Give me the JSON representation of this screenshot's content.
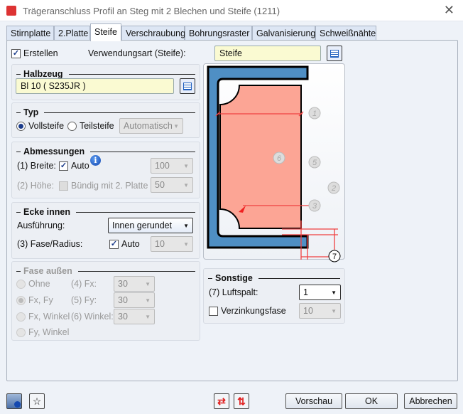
{
  "window": {
    "title": "Trägeranschluss Profil an Steg mit 2 Blechen und Steife (1211)",
    "close": "✕"
  },
  "tabs": [
    {
      "label": "Stirnplatte"
    },
    {
      "label": "2.Platte"
    },
    {
      "label": "Steife",
      "active": true
    },
    {
      "label": "Verschraubung"
    },
    {
      "label": "Bohrungsraster"
    },
    {
      "label": "Galvanisierung"
    },
    {
      "label": "Schweißnähte"
    }
  ],
  "top": {
    "create_label": "Erstellen",
    "create_checked": true,
    "usage_label": "Verwendungsart (Steife):",
    "usage_value": "Steife"
  },
  "halbzeug": {
    "title": "Halbzeug",
    "value": "Bl 10  ( S235JR )"
  },
  "typ": {
    "title": "Typ",
    "option1": "Vollsteife",
    "option2": "Teilsteife",
    "selected": "Vollsteife",
    "mode": "Automatisch"
  },
  "abmessungen": {
    "title": "Abmessungen",
    "breite_label": "(1) Breite:",
    "auto_label": "Auto",
    "breite_value": "100",
    "hoehe_label": "(2) Höhe:",
    "buendig_label": "Bündig mit 2. Platte",
    "hoehe_value": "50"
  },
  "ecke": {
    "title": "Ecke innen",
    "ausfuehrung_label": "Ausführung:",
    "ausfuehrung_value": "Innen gerundet",
    "radius_label": "(3) Fase/Radius:",
    "auto_label": "Auto",
    "radius_value": "10"
  },
  "fase": {
    "title": "Fase außen",
    "options": [
      "Ohne",
      "Fx, Fy",
      "Fx, Winkel",
      "Fy, Winkel"
    ],
    "selected": "Fx, Fy",
    "fx_label": "(4) Fx:",
    "fx_value": "30",
    "fy_label": "(5) Fy:",
    "fy_value": "30",
    "winkel_label": "(6) Winkel:",
    "winkel_value": "30"
  },
  "diagram": {
    "labels": [
      "1",
      "6",
      "5",
      "2",
      "3",
      "7"
    ],
    "colors": {
      "profile": "#4f8fc4",
      "plate": "#fca595",
      "dim": "#f04040"
    }
  },
  "sonstige": {
    "title": "Sonstige",
    "luftspalt_label": "(7) Luftspalt:",
    "luftspalt_value": "1",
    "verzinkung_label": "Verzinkungsfase",
    "verzinkung_value": "10"
  },
  "footer": {
    "preview": "Vorschau",
    "ok": "OK",
    "cancel": "Abbrechen"
  }
}
